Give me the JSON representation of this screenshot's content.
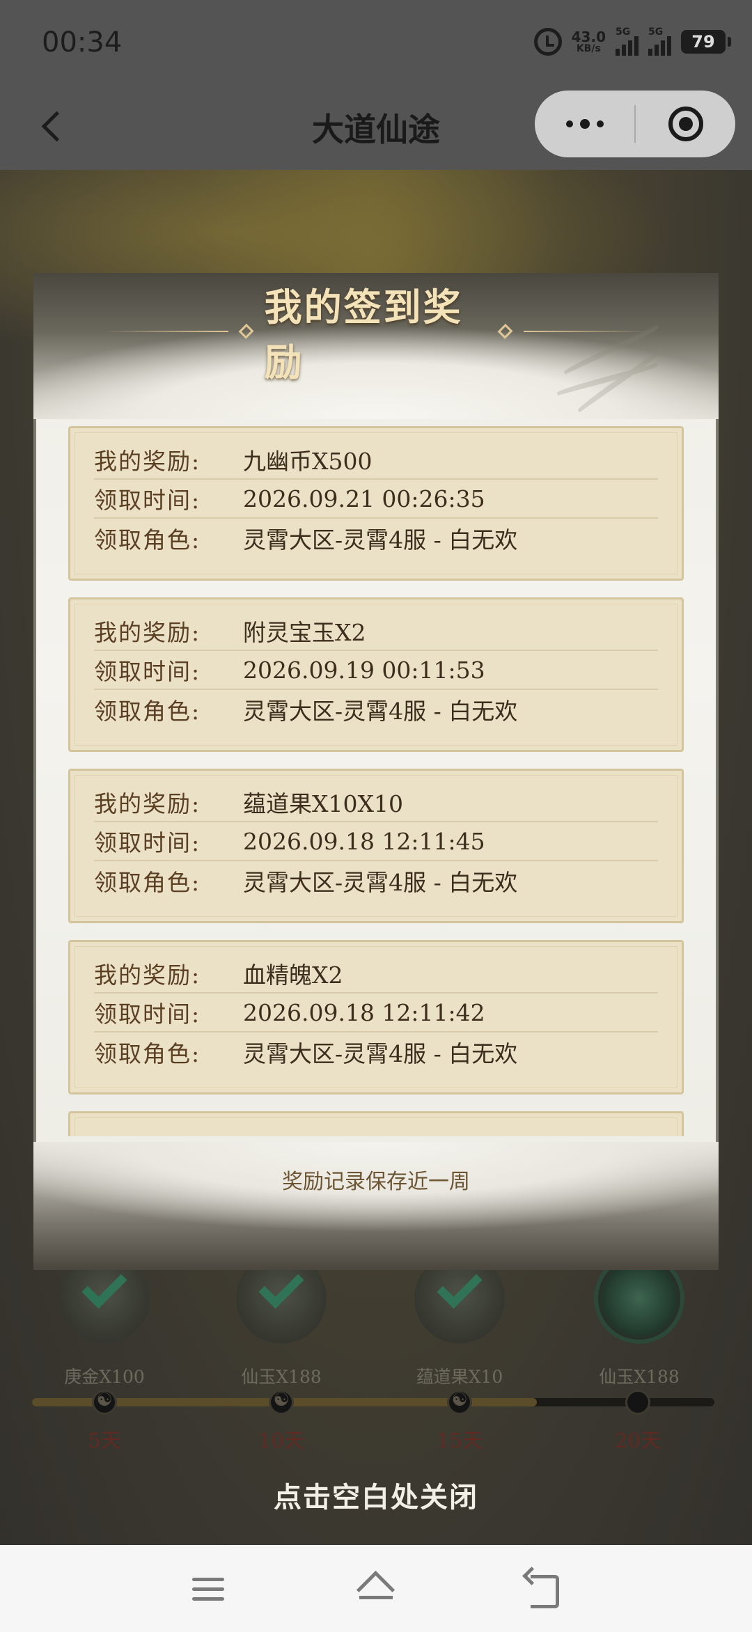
{
  "status_bar": {
    "time": "00:34",
    "net_speed": "43.0",
    "net_speed_unit": "KB/s",
    "sim1_label": "5G",
    "sim2_label": "5G",
    "battery": "79"
  },
  "title_bar": {
    "title": "大道仙途"
  },
  "panel": {
    "title": "我的签到奖励",
    "footnote": "奖励记录保存近一周",
    "records": [
      {
        "reward_label": "我的奖励:",
        "reward": "九幽币X500",
        "time_label": "领取时间:",
        "time": "2026.09.21 00:26:35",
        "role_label": "领取角色:",
        "role": "灵霄大区-灵霄4服 - 白无欢"
      },
      {
        "reward_label": "我的奖励:",
        "reward": "附灵宝玉X2",
        "time_label": "领取时间:",
        "time": "2026.09.19 00:11:53",
        "role_label": "领取角色:",
        "role": "灵霄大区-灵霄4服 - 白无欢"
      },
      {
        "reward_label": "我的奖励:",
        "reward": "蕴道果X10X10",
        "time_label": "领取时间:",
        "time": "2026.09.18 12:11:45",
        "role_label": "领取角色:",
        "role": "灵霄大区-灵霄4服 - 白无欢"
      },
      {
        "reward_label": "我的奖励:",
        "reward": "血精魄X2",
        "time_label": "领取时间:",
        "time": "2026.09.18 12:11:42",
        "role_label": "领取角色:",
        "role": "灵霄大区-灵霄4服 - 白无欢"
      }
    ]
  },
  "progress": {
    "rewards": [
      {
        "name": "庚金X100",
        "day": "5天",
        "claimed": true
      },
      {
        "name": "仙玉X188",
        "day": "10天",
        "claimed": true
      },
      {
        "name": "蕴道果X10",
        "day": "15天",
        "claimed": true
      },
      {
        "name": "仙玉X188",
        "day": "20天",
        "claimed": false
      }
    ],
    "filled_fraction": 0.74
  },
  "close_hint": "点击空白处关闭",
  "icons": {
    "back": "chevron-left-icon",
    "more": "more-dots-icon",
    "close": "target-close-icon",
    "alarm": "alarm-icon",
    "nav_menu": "menu-icon",
    "nav_home": "home-icon",
    "nav_back": "back-icon"
  }
}
